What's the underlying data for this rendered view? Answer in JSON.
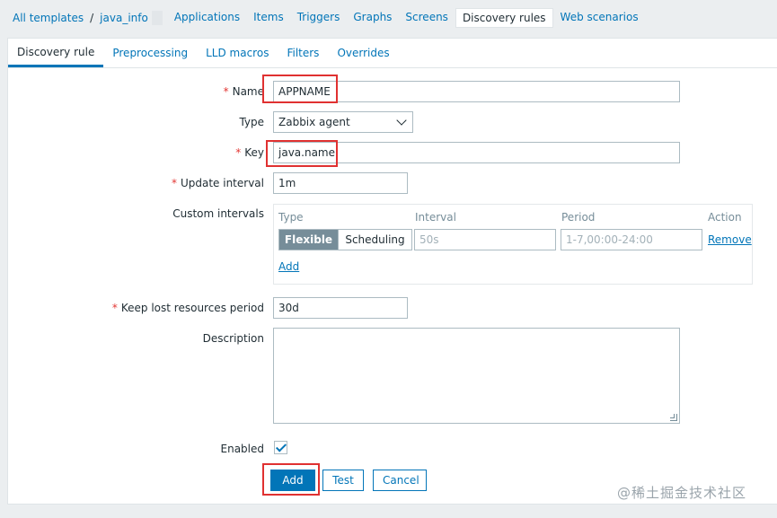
{
  "breadcrumb": {
    "all_templates": "All templates",
    "separator": "/",
    "template": "java_info"
  },
  "nav_tabs": [
    "Applications",
    "Items",
    "Triggers",
    "Graphs",
    "Screens",
    "Discovery rules",
    "Web scenarios"
  ],
  "sub_tabs": [
    "Discovery rule",
    "Preprocessing",
    "LLD macros",
    "Filters",
    "Overrides"
  ],
  "form": {
    "required_mark": "*",
    "name_label": "Name",
    "name_value": "APPNAME",
    "type_label": "Type",
    "type_value": "Zabbix agent",
    "key_label": "Key",
    "key_value": "java.name",
    "update_interval_label": "Update interval",
    "update_interval_value": "1m",
    "custom_intervals_label": "Custom intervals",
    "ci": {
      "col_type": "Type",
      "col_interval": "Interval",
      "col_period": "Period",
      "col_action": "Action",
      "flexible": "Flexible",
      "scheduling": "Scheduling",
      "interval_placeholder": "50s",
      "period_placeholder": "1-7,00:00-24:00",
      "remove": "Remove",
      "add": "Add"
    },
    "keep_lost_label": "Keep lost resources period",
    "keep_lost_value": "30d",
    "description_label": "Description",
    "description_value": "",
    "enabled_label": "Enabled",
    "enabled": true
  },
  "buttons": {
    "add": "Add",
    "test": "Test",
    "cancel": "Cancel"
  },
  "watermark": "@稀土掘金技术社区",
  "colors": {
    "link": "#0275b8",
    "required": "#e33734",
    "highlight": "#e03131",
    "toggle_on": "#768d99"
  }
}
